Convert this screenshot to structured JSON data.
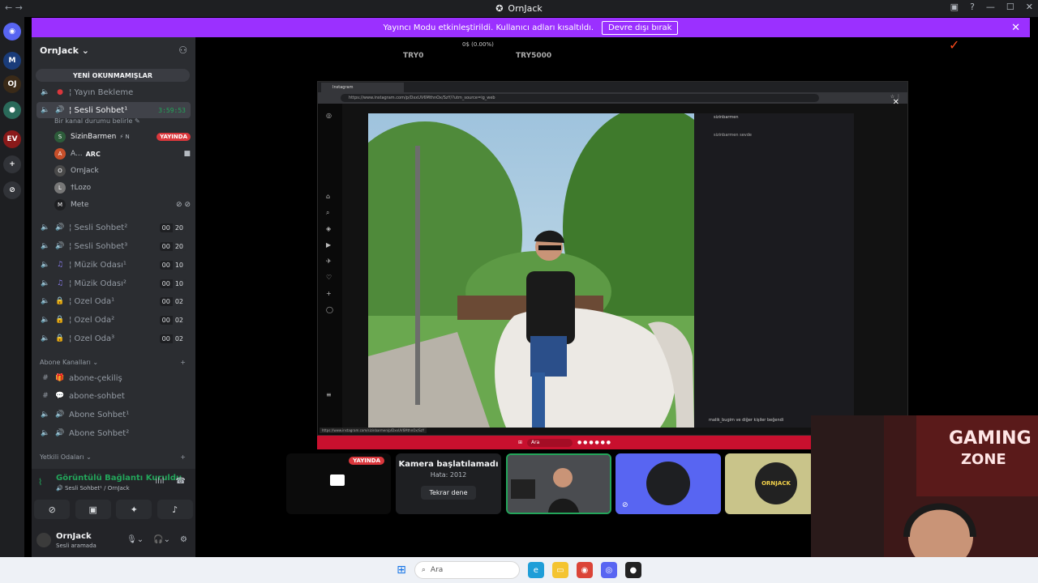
{
  "titlebar": {
    "title": "OrnJack",
    "nav": "← →"
  },
  "banner": {
    "text": "Yayıncı Modu etkinleştirildi. Kullanıcı adları kısaltıldı.",
    "button": "Devre dışı bırak"
  },
  "server": {
    "name": "OrnJack",
    "unread": "YENİ OKUNMAMIŞLAR"
  },
  "channels": [
    {
      "name": "¦ Yayın Bekleme"
    },
    {
      "name": "¦ Sesli Sohbet¹",
      "timer": "3:59:53",
      "status": "Bir kanal durumu belirle"
    },
    {
      "name": "¦ Sesli Sohbet²",
      "a": "00",
      "b": "20"
    },
    {
      "name": "¦ Sesli Sohbet³",
      "a": "00",
      "b": "20"
    },
    {
      "name": "¦ Müzik Odası¹",
      "a": "00",
      "b": "10"
    },
    {
      "name": "¦ Müzik Odası²",
      "a": "00",
      "b": "10"
    },
    {
      "name": "¦ Özel Oda¹",
      "a": "00",
      "b": "02"
    },
    {
      "name": "¦ Özel Oda²",
      "a": "00",
      "b": "02"
    },
    {
      "name": "¦ Özel Oda³",
      "a": "00",
      "b": "02"
    }
  ],
  "voice_users": [
    {
      "name": "SizinBarmen",
      "badge": "YAYINDA"
    },
    {
      "name": "A...",
      "tag": "ARC"
    },
    {
      "name": "OrnJack"
    },
    {
      "name": "†Lozo"
    },
    {
      "name": "Mete"
    }
  ],
  "categories": {
    "abone": "Abone Kanalları",
    "yetkili": "Yetkili Odaları"
  },
  "abone_channels": [
    {
      "name": "abone-çekiliş"
    },
    {
      "name": "abone-sohbet"
    },
    {
      "name": "Abone Sohbet¹"
    },
    {
      "name": "Abone Sohbet²"
    }
  ],
  "voice_panel": {
    "status": "Görüntülü Bağlantı Kuruldu",
    "sub": "Sesli Sohbet¹ / OrnJack"
  },
  "me": {
    "name": "OrnJack",
    "sub": "Sesli aramada"
  },
  "stream_hud": {
    "pct": "0$ (0.00%)",
    "left": "TRY0",
    "right": "TRY5000"
  },
  "browser": {
    "tab": "Instagram",
    "url": "https://www.instagram.com/p/DxxUV6MthnOx/SzY/?utm_source=ig_web",
    "status_url": "https://www.instagram.com/sizinbarmen/p/DxxUV6MthnOx/SzY",
    "user": "sizinbarmen",
    "comment": "sizinbarmen sevde",
    "likes": "malik_bugim ve diğer kişiler beğendi",
    "search": "Ara"
  },
  "tiles": {
    "live": "YAYINDA",
    "cam_title": "Kamera başlatılamadı",
    "cam_error": "Hata: 2012",
    "cam_retry": "Tekrar dene",
    "ornjack": "ORNJACK"
  },
  "taskbar": {
    "search": "Ara"
  },
  "colors": {
    "accent": "#9b30ff",
    "live": "#da373c",
    "online": "#23a55a",
    "blurple": "#5865f2"
  }
}
